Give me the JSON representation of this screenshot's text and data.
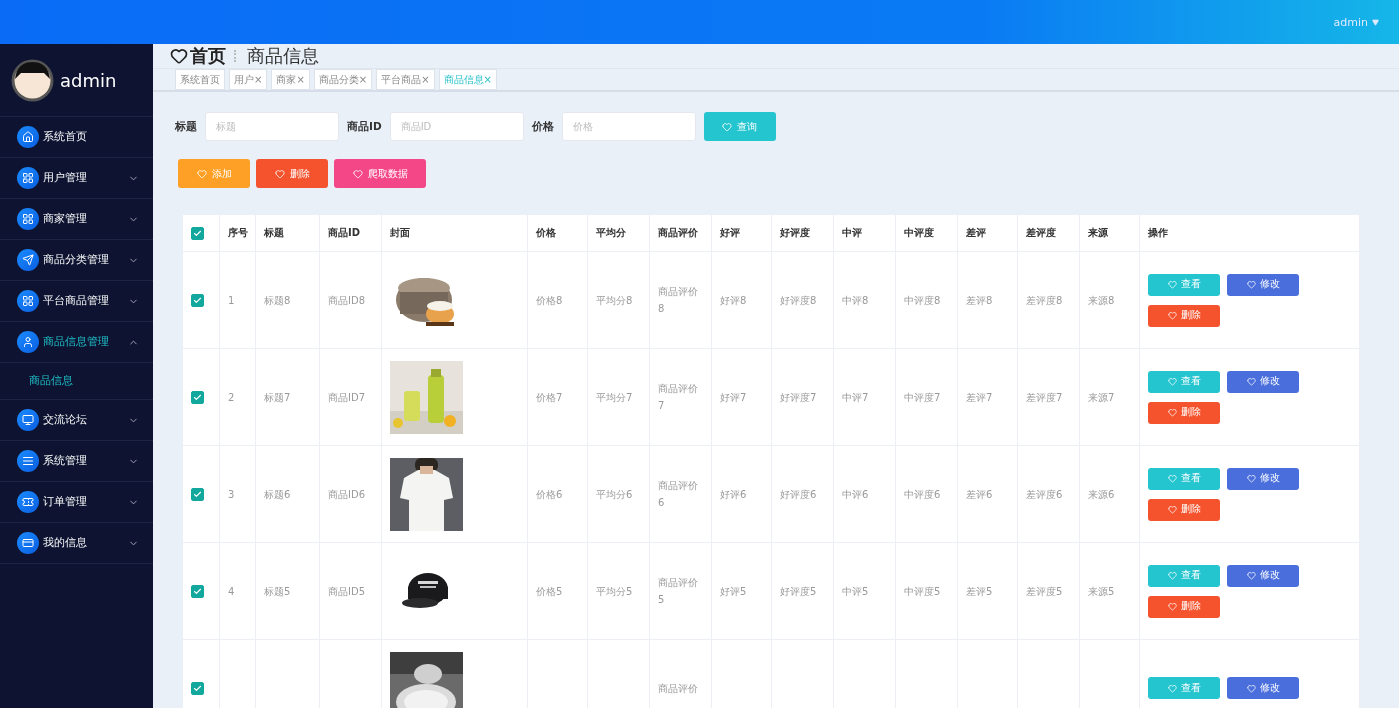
{
  "top_bar": {
    "user": "admin"
  },
  "sidebar": {
    "user": "admin",
    "items": [
      {
        "label": "系统首页",
        "kind": "link",
        "selected": false
      },
      {
        "label": "用户管理",
        "kind": "group",
        "selected": false,
        "expanded": false
      },
      {
        "label": "商家管理",
        "kind": "group",
        "selected": false,
        "expanded": false
      },
      {
        "label": "商品分类管理",
        "kind": "group",
        "selected": false,
        "expanded": false
      },
      {
        "label": "平台商品管理",
        "kind": "group",
        "selected": false,
        "expanded": false
      },
      {
        "label": "商品信息管理",
        "kind": "group",
        "selected": true,
        "expanded": true,
        "children": [
          {
            "label": "商品信息",
            "selected": true
          }
        ]
      },
      {
        "label": "交流论坛",
        "kind": "group",
        "selected": false,
        "expanded": false
      },
      {
        "label": "系统管理",
        "kind": "group",
        "selected": false,
        "expanded": false
      },
      {
        "label": "订单管理",
        "kind": "group",
        "selected": false,
        "expanded": false
      },
      {
        "label": "我的信息",
        "kind": "group",
        "selected": false,
        "expanded": false
      }
    ]
  },
  "breadcrumb": {
    "home": "首页",
    "current": "商品信息"
  },
  "tabs": [
    {
      "label": "系统首页",
      "selected": false
    },
    {
      "label": "用户",
      "close": "×",
      "selected": false
    },
    {
      "label": "商家",
      "close": "×",
      "selected": false
    },
    {
      "label": "商品分类",
      "close": "×",
      "selected": false
    },
    {
      "label": "平台商品",
      "close": "×",
      "selected": false
    },
    {
      "label": "商品信息",
      "close": "×",
      "selected": true
    }
  ],
  "search": {
    "fields": [
      {
        "label": "标题",
        "placeholder": "标题"
      },
      {
        "label": "商品ID",
        "placeholder": "商品ID"
      },
      {
        "label": "价格",
        "placeholder": "价格"
      }
    ],
    "button": "查询"
  },
  "actions": [
    {
      "label": "添加",
      "kind": "add"
    },
    {
      "label": "删除",
      "kind": "delete"
    },
    {
      "label": "爬取数据",
      "kind": "crawl"
    }
  ],
  "table": {
    "all_checked": true,
    "columns": [
      {
        "label": "序号"
      },
      {
        "label": "标题"
      },
      {
        "label": "商品ID"
      },
      {
        "label": "封面",
        "kind": "picture"
      },
      {
        "label": "价格"
      },
      {
        "label": "平均分"
      },
      {
        "label": "商品评价"
      },
      {
        "label": "好评"
      },
      {
        "label": "好评度"
      },
      {
        "label": "中评"
      },
      {
        "label": "中评度"
      },
      {
        "label": "差评"
      },
      {
        "label": "差评度"
      },
      {
        "label": "来源"
      },
      {
        "label": "操作",
        "kind": "actions"
      }
    ],
    "rows": [
      {
        "checked": true,
        "cells": [
          "1",
          "标题8",
          "商品ID8",
          {
            "kind": "picture"
          },
          "价格8",
          "平均分8",
          "商品评价8",
          "好评8",
          "好评度8",
          "中评8",
          "中评度8",
          "差评8",
          "差评度8",
          "来源8"
        ],
        "buttons": [
          {
            "label": "查看",
            "kind": "view"
          },
          {
            "label": "修改",
            "kind": "edit"
          },
          {
            "label": "删除",
            "kind": "delete"
          }
        ]
      },
      {
        "checked": true,
        "cells": [
          "2",
          "标题7",
          "商品ID7",
          {
            "kind": "picture"
          },
          "价格7",
          "平均分7",
          "商品评价7",
          "好评7",
          "好评度7",
          "中评7",
          "中评度7",
          "差评7",
          "差评度7",
          "来源7"
        ],
        "buttons": [
          {
            "label": "查看",
            "kind": "view"
          },
          {
            "label": "修改",
            "kind": "edit"
          },
          {
            "label": "删除",
            "kind": "delete"
          }
        ]
      },
      {
        "checked": true,
        "cells": [
          "3",
          "标题6",
          "商品ID6",
          {
            "kind": "picture"
          },
          "价格6",
          "平均分6",
          "商品评价6",
          "好评6",
          "好评度6",
          "中评6",
          "中评度6",
          "差评6",
          "差评度6",
          "来源6"
        ],
        "buttons": [
          {
            "label": "查看",
            "kind": "view"
          },
          {
            "label": "修改",
            "kind": "edit"
          },
          {
            "label": "删除",
            "kind": "delete"
          }
        ]
      },
      {
        "checked": true,
        "cells": [
          "4",
          "标题5",
          "商品ID5",
          {
            "kind": "picture"
          },
          "价格5",
          "平均分5",
          "商品评价5",
          "好评5",
          "好评度5",
          "中评5",
          "中评度5",
          "差评5",
          "差评度5",
          "来源5"
        ],
        "buttons": [
          {
            "label": "查看",
            "kind": "view"
          },
          {
            "label": "修改",
            "kind": "edit"
          },
          {
            "label": "删除",
            "kind": "delete"
          }
        ]
      },
      {
        "checked": true,
        "cells": [
          "",
          "",
          "",
          {
            "kind": "picture"
          },
          "",
          "",
          "商品评价",
          "",
          "",
          "",
          "",
          "",
          "",
          ""
        ],
        "buttons": [
          {
            "label": "查看",
            "kind": "view"
          },
          {
            "label": "修改",
            "kind": "edit"
          }
        ]
      }
    ]
  }
}
